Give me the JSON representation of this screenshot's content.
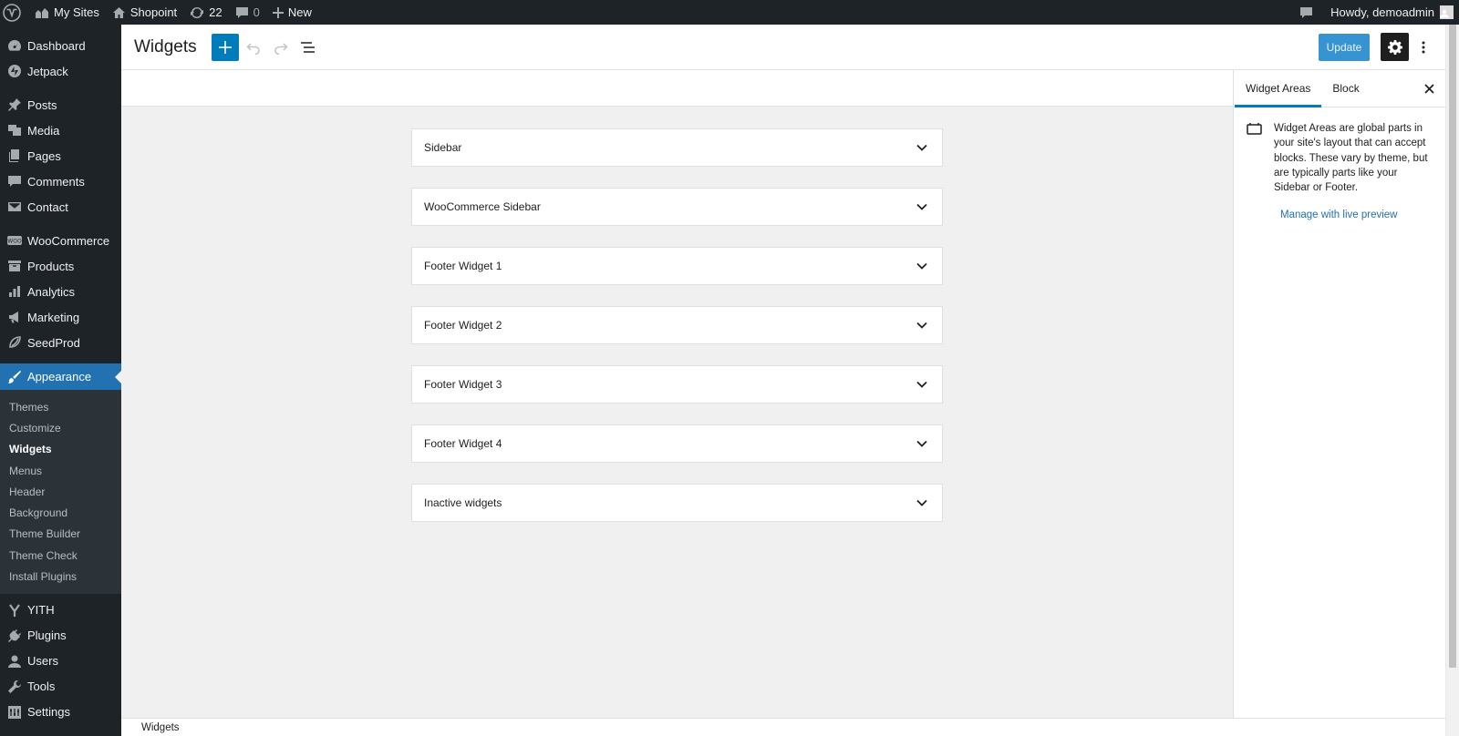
{
  "adminbar": {
    "my_sites": "My Sites",
    "site_name": "Shopoint",
    "updates_count": "22",
    "comments_count": "0",
    "new_label": "New",
    "howdy": "Howdy, demoadmin"
  },
  "menu": {
    "dashboard": "Dashboard",
    "jetpack": "Jetpack",
    "posts": "Posts",
    "media": "Media",
    "pages": "Pages",
    "comments": "Comments",
    "contact": "Contact",
    "woocommerce": "WooCommerce",
    "products": "Products",
    "analytics": "Analytics",
    "marketing": "Marketing",
    "seedprod": "SeedProd",
    "appearance": "Appearance",
    "yith": "YITH",
    "plugins": "Plugins",
    "users": "Users",
    "tools": "Tools",
    "settings": "Settings"
  },
  "submenu": {
    "themes": "Themes",
    "customize": "Customize",
    "widgets": "Widgets",
    "menus": "Menus",
    "header": "Header",
    "background": "Background",
    "theme_builder": "Theme Builder",
    "theme_check": "Theme Check",
    "install_plugins": "Install Plugins"
  },
  "editor": {
    "title": "Widgets",
    "update_label": "Update"
  },
  "areas": {
    "a0": "Sidebar",
    "a1": "WooCommerce Sidebar",
    "a2": "Footer Widget 1",
    "a3": "Footer Widget 2",
    "a4": "Footer Widget 3",
    "a5": "Footer Widget 4",
    "a6": "Inactive widgets"
  },
  "panel": {
    "tab_widget_areas": "Widget Areas",
    "tab_block": "Block",
    "description": "Widget Areas are global parts in your site's layout that can accept blocks. These vary by theme, but are typically parts like your Sidebar or Footer.",
    "link": "Manage with live preview"
  },
  "footer": {
    "breadcrumb": "Widgets"
  },
  "colors": {
    "accent": "#007cba",
    "admin_dark": "#1d2327",
    "menu_current": "#2271b1"
  }
}
